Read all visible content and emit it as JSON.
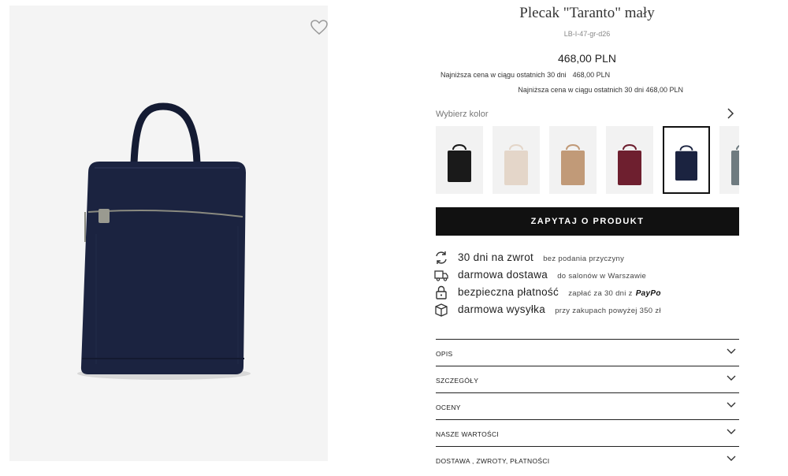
{
  "product": {
    "title": "Plecak \"Taranto\" mały",
    "sku": "LB-I-47-gr-d26",
    "price": "468,00 PLN",
    "lowest_price_line1_label": "Najniższa cena w ciągu ostatnich 30 dni",
    "lowest_price_line1_value": "468,00 PLN",
    "lowest_price_line2": "Najniższa cena w ciągu ostatnich 30 dni 468,00 PLN"
  },
  "colors": {
    "label": "Wybierz kolor",
    "swatches": [
      {
        "name": "czarny",
        "hex": "#1a1a1a"
      },
      {
        "name": "beżowy",
        "hex": "#e4d6c9"
      },
      {
        "name": "karmelowy",
        "hex": "#c19a78"
      },
      {
        "name": "bordowy",
        "hex": "#6e1f2f"
      },
      {
        "name": "granatowy",
        "hex": "#1b2340",
        "selected": true
      },
      {
        "name": "szary",
        "hex": "#6f7b80"
      }
    ]
  },
  "ask_button": "ZAPYTAJ O PRODUKT",
  "features": [
    {
      "icon": "return-icon",
      "main": "30 dni na zwrot",
      "sub": "bez podania przyczyny"
    },
    {
      "icon": "truck-icon",
      "main": "darmowa dostawa",
      "sub": "do salonów w Warszawie"
    },
    {
      "icon": "lock-icon",
      "main": "bezpieczna płatność",
      "sub": "zapłać za 30 dni z",
      "brand": "PayPo"
    },
    {
      "icon": "box-icon",
      "main": "darmowa wysyłka",
      "sub": "przy zakupach powyżej 350 zł"
    }
  ],
  "accordion": [
    "OPIS",
    "SZCZEGÓŁY",
    "OCENY",
    "NASZE WARTOŚCI",
    "DOSTAWA , ZWROTY, PŁATNOŚCI"
  ],
  "image": {
    "bag_color": "#1b2340",
    "background": "#f4f4f4"
  }
}
